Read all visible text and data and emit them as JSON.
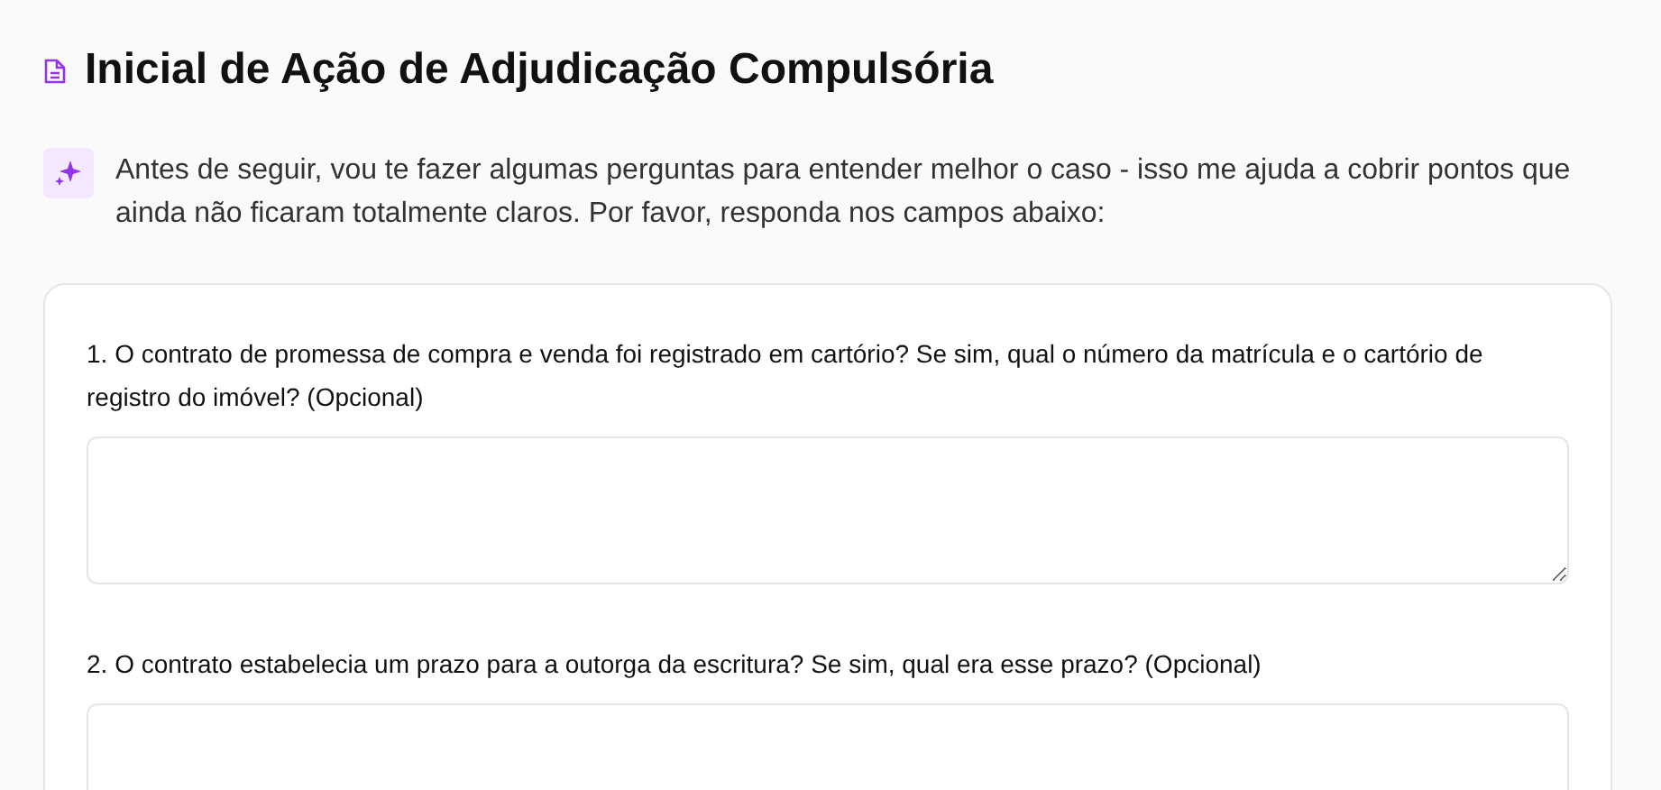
{
  "title": "Inicial de Ação de Adjudicação Compulsória",
  "intro": "Antes de seguir, vou te fazer algumas perguntas para entender melhor o caso - isso me ajuda a cobrir pontos que ainda não ficaram totalmente claros. Por favor, responda nos campos abaixo:",
  "questions": [
    {
      "label": "1. O contrato de promessa de compra e venda foi registrado em cartório? Se sim, qual o número da matrícula e o cartório de registro do imóvel? (Opcional)"
    },
    {
      "label": "2. O contrato estabelecia um prazo para a outorga da escritura? Se sim, qual era esse prazo? (Opcional)"
    }
  ]
}
